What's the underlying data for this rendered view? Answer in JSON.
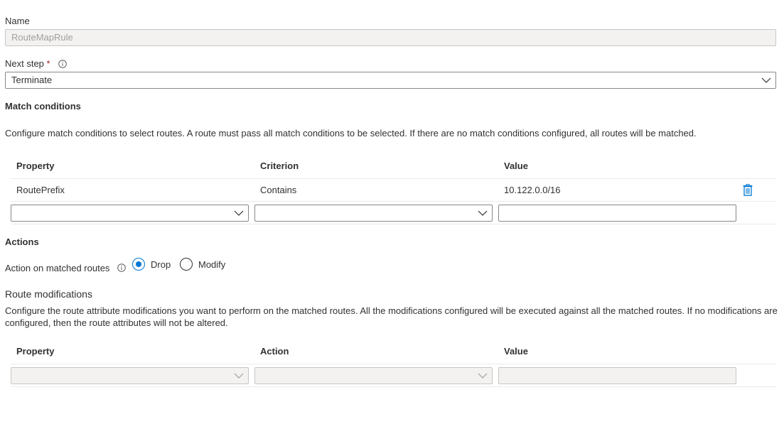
{
  "name_field": {
    "label": "Name",
    "value": "RouteMapRule"
  },
  "next_step": {
    "label": "Next step",
    "required_marker": "*",
    "info_icon": "info-icon",
    "selected": "Terminate"
  },
  "match_conditions": {
    "title": "Match conditions",
    "description": "Configure match conditions to select routes. A route must pass all match conditions to be selected. If there are no match conditions configured, all routes will be matched.",
    "columns": {
      "property": "Property",
      "criterion": "Criterion",
      "value": "Value"
    },
    "rows": [
      {
        "property": "RoutePrefix",
        "criterion": "Contains",
        "value": "10.122.0.0/16",
        "delete_icon": "trash-icon"
      }
    ],
    "new_row": {
      "property": "",
      "criterion": "",
      "value": ""
    }
  },
  "actions": {
    "title": "Actions",
    "action_label": "Action on matched routes",
    "info_icon": "info-icon",
    "options": [
      {
        "label": "Drop",
        "checked": true
      },
      {
        "label": "Modify",
        "checked": false
      }
    ]
  },
  "route_modifications": {
    "title": "Route modifications",
    "description": "Configure the route attribute modifications you want to perform on the matched routes. All the modifications configured will be executed against all the matched routes. If no modifications are configured, then the route attributes will not be altered.",
    "columns": {
      "property": "Property",
      "action": "Action",
      "value": "Value"
    },
    "new_row": {
      "property": "",
      "action": "",
      "value": ""
    }
  },
  "colors": {
    "accent": "#0078d4",
    "required": "#a4262c",
    "border": "#8a8886",
    "disabled_bg": "#f3f2f1"
  }
}
